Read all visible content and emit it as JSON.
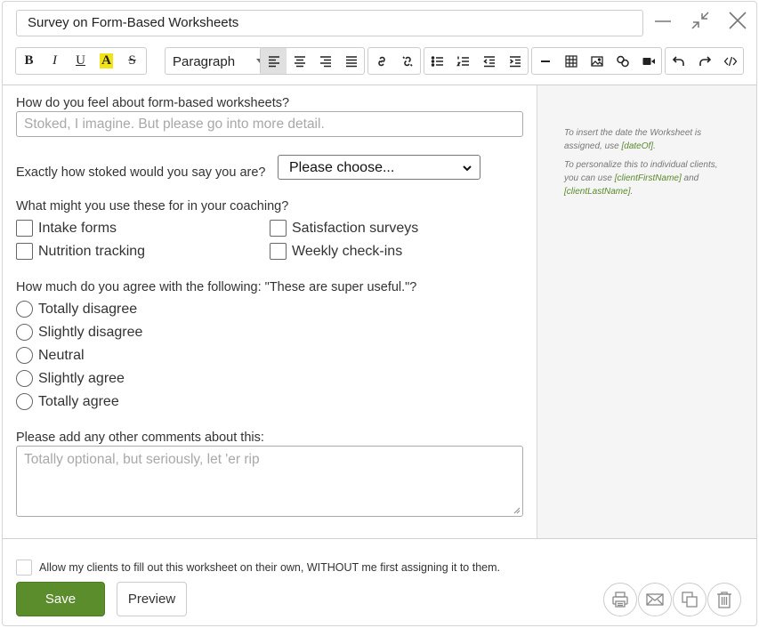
{
  "title": {
    "value": "Survey on Form-Based Worksheets"
  },
  "toolbar": {
    "bold": "B",
    "italic": "I",
    "underline": "U",
    "highlight": "A",
    "strike": "S",
    "paragraph": "Paragraph"
  },
  "sidebar": {
    "hint1_text": "To insert the date the Worksheet is assigned, use ",
    "hint1_tag": "[dateOf]",
    "hint1_end": ".",
    "hint2_text": "To personalize this to individual clients, you can use ",
    "hint2_tag1": "[clientFirstName]",
    "hint2_and": " and ",
    "hint2_tag2": "[clientLastName]",
    "hint2_end": "."
  },
  "form": {
    "q1": "How do you feel about form-based worksheets?",
    "q1_placeholder": "Stoked, I imagine. But please go into more detail.",
    "q2": "Exactly how stoked would you say you are?",
    "q2_select": "Please choose...",
    "q3": "What might you use these for in your coaching?",
    "q3_options": [
      "Intake forms",
      "Satisfaction surveys",
      "Nutrition tracking",
      "Weekly check-ins"
    ],
    "q4": "How much do you agree with the following: \"These are super useful.\"?",
    "q4_options": [
      "Totally disagree",
      "Slightly disagree",
      "Neutral",
      "Slightly agree",
      "Totally agree"
    ],
    "q5": "Please add any other comments about this:",
    "q5_placeholder": "Totally optional, but seriously, let 'er rip"
  },
  "footer": {
    "allow_label": "Allow my clients to fill out this worksheet on their own, WITHOUT me first assigning it to them.",
    "save": "Save",
    "preview": "Preview"
  }
}
